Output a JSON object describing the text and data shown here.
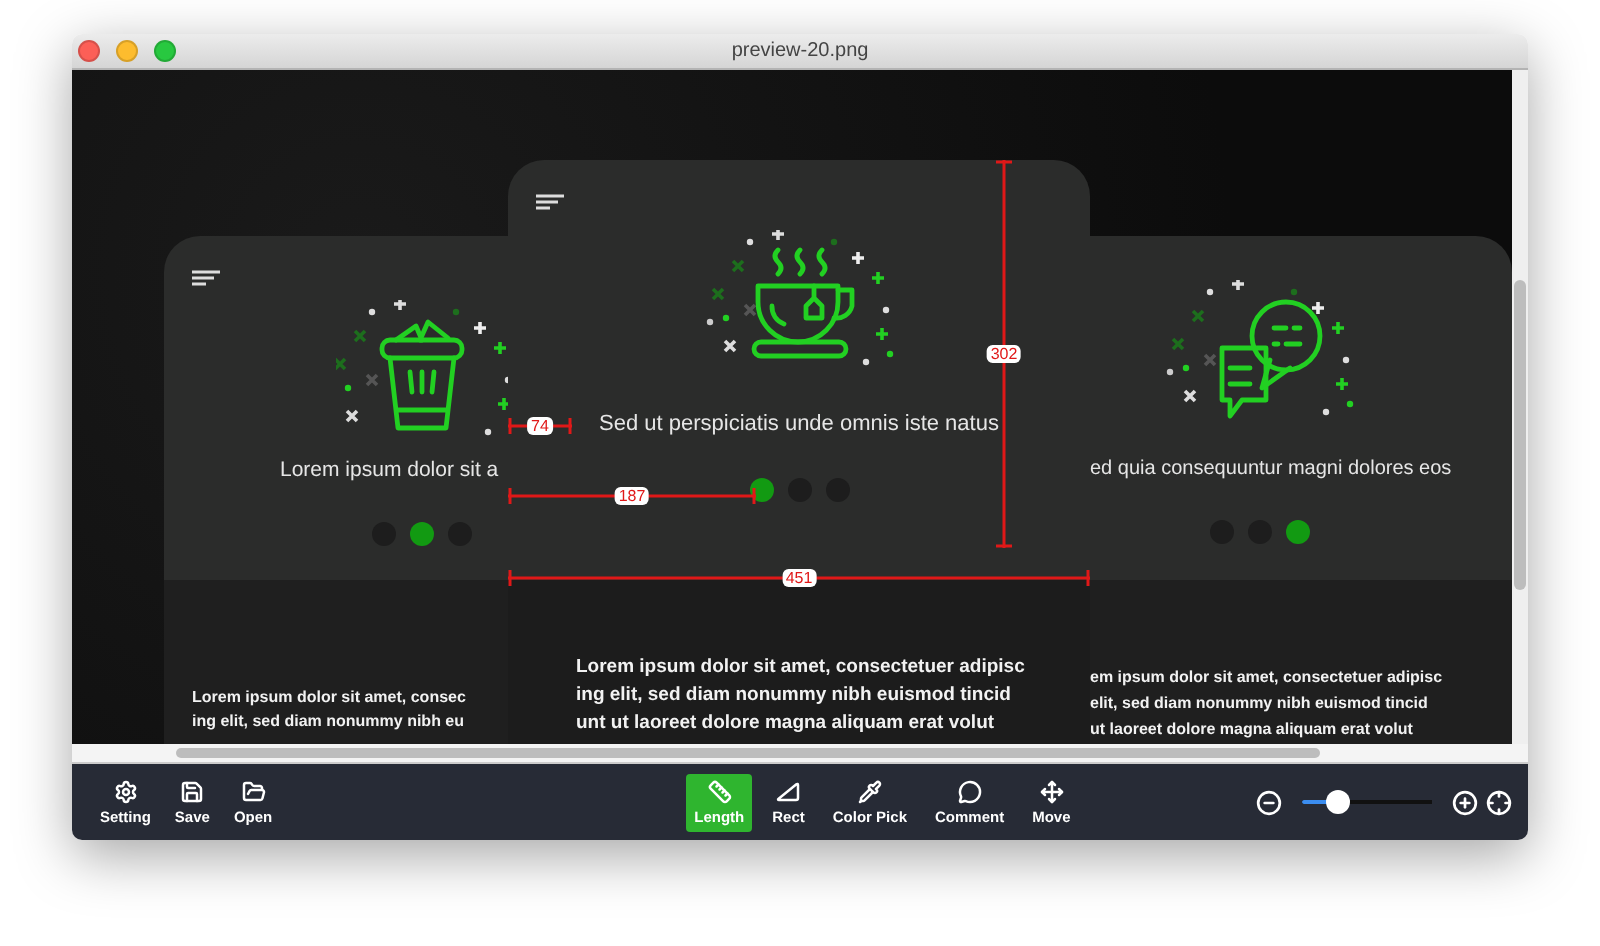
{
  "window": {
    "title": "preview-20.png"
  },
  "canvas": {
    "cards": [
      {
        "kind": "trash",
        "menu_visible": true,
        "caption": "Lorem ipsum dolor sit a",
        "dots": [
          {
            "selected": false
          },
          {
            "selected": true
          },
          {
            "selected": false
          }
        ],
        "body": "Lorem ipsum dolor sit amet, consec\ning elit, sed diam nonummy nibh eu"
      },
      {
        "kind": "cup",
        "menu_visible": true,
        "caption": "Sed ut perspiciatis unde omnis iste natus",
        "dots": [
          {
            "selected": true
          },
          {
            "selected": false
          },
          {
            "selected": false
          }
        ],
        "body": "Lorem ipsum dolor sit amet, consectetuer adipisc\ning elit, sed diam nonummy nibh euismod tincid\nunt ut laoreet dolore magna aliquam erat volut"
      },
      {
        "kind": "chat",
        "menu_visible": false,
        "caption": "ed quia consequuntur magni dolores eos",
        "dots": [
          {
            "selected": false
          },
          {
            "selected": false
          },
          {
            "selected": true
          }
        ],
        "body": "em ipsum dolor sit amet, consectetuer adipisc\nelit, sed diam nonummy nibh euismod tincid\nut laoreet dolore magna aliquam erat volut"
      }
    ],
    "measurements": [
      {
        "label": "302",
        "kind": "vertical"
      },
      {
        "label": "74",
        "kind": "horizontal"
      },
      {
        "label": "187",
        "kind": "horizontal"
      },
      {
        "label": "451",
        "kind": "horizontal"
      }
    ]
  },
  "toolbar": {
    "file_buttons": [
      {
        "kind": "setting",
        "label": "Setting"
      },
      {
        "kind": "save",
        "label": "Save"
      },
      {
        "kind": "open",
        "label": "Open"
      }
    ],
    "tools": [
      {
        "kind": "length",
        "label": "Length",
        "selected": true
      },
      {
        "kind": "rect",
        "label": "Rect",
        "selected": false
      },
      {
        "kind": "color_pick",
        "label": "Color Pick",
        "selected": false
      },
      {
        "kind": "comment",
        "label": "Comment",
        "selected": false
      },
      {
        "kind": "move",
        "label": "Move",
        "selected": false
      }
    ],
    "zoom": {
      "level": 0.28
    }
  }
}
